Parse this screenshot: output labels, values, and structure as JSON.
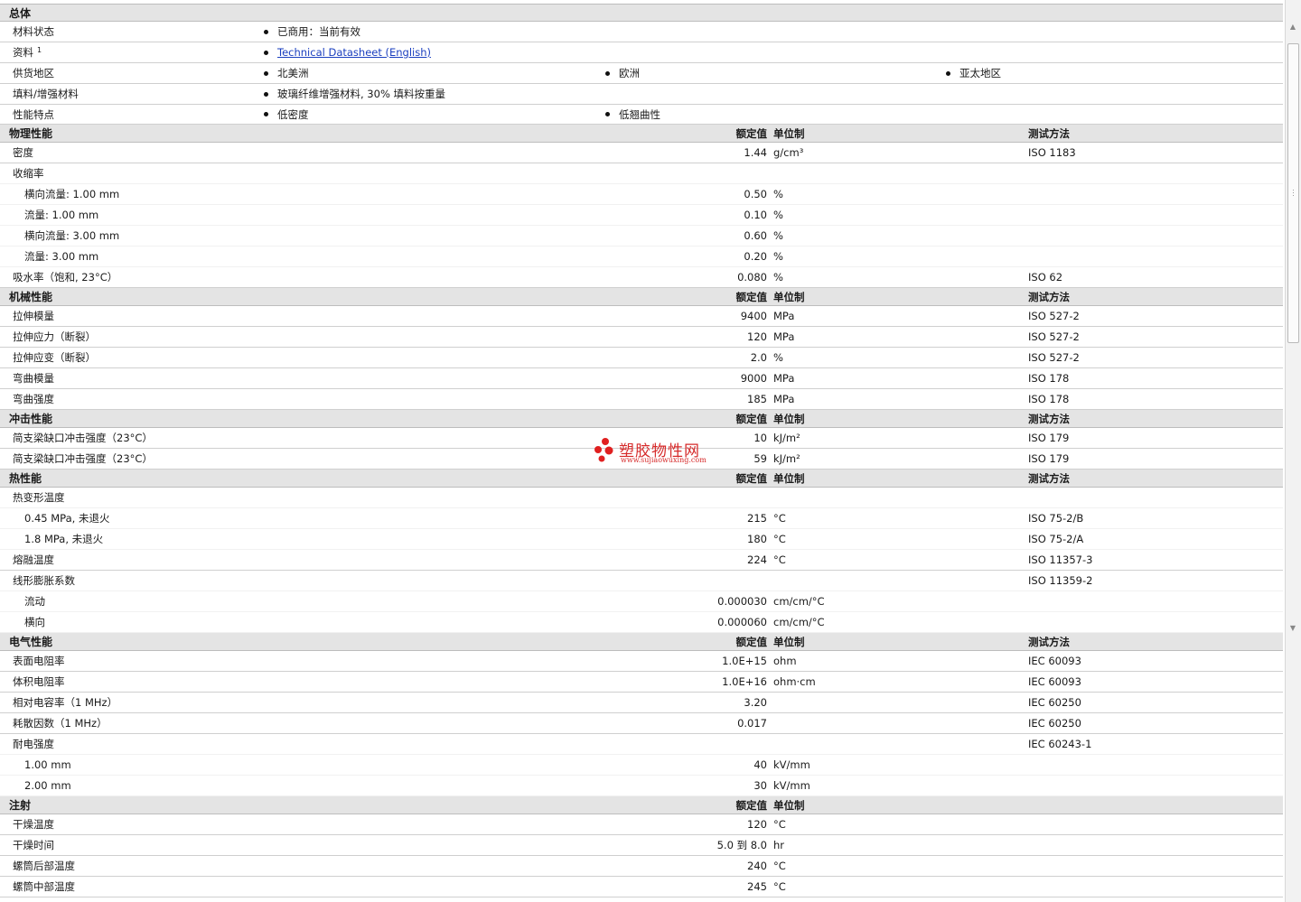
{
  "general": {
    "title": "总体",
    "status_label": "材料状态",
    "status_value": "已商用：当前有效",
    "doc_label": "资料",
    "doc_sup": "1",
    "doc_link": "Technical Datasheet (English)",
    "region_label": "供货地区",
    "regions": [
      "北美洲",
      "欧洲",
      "亚太地区"
    ],
    "filler_label": "填料/增强材料",
    "filler_value": "玻璃纤维增强材料, 30% 填料按重量",
    "features_label": "性能特点",
    "features": [
      "低密度",
      "低翘曲性"
    ]
  },
  "headers": {
    "value": "额定值",
    "unit": "单位制",
    "test": "测试方法"
  },
  "sections": [
    {
      "title": "物理性能",
      "show_test": true,
      "rows": [
        {
          "label": "密度",
          "value": "1.44",
          "unit": "g/cm³",
          "test": "ISO 1183"
        },
        {
          "label": "收缩率",
          "value": "",
          "unit": "",
          "test": ""
        },
        {
          "label": "横向流量: 1.00 mm",
          "indent": true,
          "value": "0.50",
          "unit": "%",
          "test": ""
        },
        {
          "label": "流量: 1.00 mm",
          "indent": true,
          "value": "0.10",
          "unit": "%",
          "test": ""
        },
        {
          "label": "横向流量: 3.00 mm",
          "indent": true,
          "value": "0.60",
          "unit": "%",
          "test": ""
        },
        {
          "label": "流量: 3.00 mm",
          "indent": true,
          "value": "0.20",
          "unit": "%",
          "test": ""
        },
        {
          "label": "吸水率（饱和, 23°C）",
          "value": "0.080",
          "unit": "%",
          "test": "ISO 62"
        }
      ]
    },
    {
      "title": "机械性能",
      "show_test": true,
      "rows": [
        {
          "label": "拉伸模量",
          "value": "9400",
          "unit": "MPa",
          "test": "ISO 527-2"
        },
        {
          "label": "拉伸应力（断裂）",
          "value": "120",
          "unit": "MPa",
          "test": "ISO 527-2"
        },
        {
          "label": "拉伸应变（断裂）",
          "value": "2.0",
          "unit": "%",
          "test": "ISO 527-2"
        },
        {
          "label": "弯曲模量",
          "value": "9000",
          "unit": "MPa",
          "test": "ISO 178"
        },
        {
          "label": "弯曲强度",
          "value": "185",
          "unit": "MPa",
          "test": "ISO 178"
        }
      ]
    },
    {
      "title": "冲击性能",
      "show_test": true,
      "rows": [
        {
          "label": "简支梁缺口冲击强度（23°C）",
          "value": "10",
          "unit": "kJ/m²",
          "test": "ISO 179"
        },
        {
          "label": "简支梁缺口冲击强度（23°C）",
          "value": "59",
          "unit": "kJ/m²",
          "test": "ISO 179"
        }
      ]
    },
    {
      "title": "热性能",
      "show_test": true,
      "rows": [
        {
          "label": "热变形温度",
          "value": "",
          "unit": "",
          "test": ""
        },
        {
          "label": "0.45 MPa, 未退火",
          "indent": true,
          "value": "215",
          "unit": "°C",
          "test": "ISO 75-2/B"
        },
        {
          "label": "1.8 MPa, 未退火",
          "indent": true,
          "value": "180",
          "unit": "°C",
          "test": "ISO 75-2/A"
        },
        {
          "label": "熔融温度",
          "value": "224",
          "unit": "°C",
          "test": "ISO 11357-3"
        },
        {
          "label": "线形膨胀系数",
          "value": "",
          "unit": "",
          "test": "ISO 11359-2"
        },
        {
          "label": "流动",
          "indent": true,
          "value": "0.000030",
          "unit": "cm/cm/°C",
          "test": ""
        },
        {
          "label": "横向",
          "indent": true,
          "value": "0.000060",
          "unit": "cm/cm/°C",
          "test": ""
        }
      ]
    },
    {
      "title": "电气性能",
      "show_test": true,
      "rows": [
        {
          "label": "表面电阻率",
          "value": "1.0E+15",
          "unit": "ohm",
          "test": "IEC 60093"
        },
        {
          "label": "体积电阻率",
          "value": "1.0E+16",
          "unit": "ohm·cm",
          "test": "IEC 60093"
        },
        {
          "label": "相对电容率（1 MHz）",
          "value": "3.20",
          "unit": "",
          "test": "IEC 60250"
        },
        {
          "label": "耗散因数（1 MHz）",
          "value": "0.017",
          "unit": "",
          "test": "IEC 60250"
        },
        {
          "label": "耐电强度",
          "value": "",
          "unit": "",
          "test": "IEC 60243-1"
        },
        {
          "label": "1.00 mm",
          "indent": true,
          "value": "40",
          "unit": "kV/mm",
          "test": ""
        },
        {
          "label": "2.00 mm",
          "indent": true,
          "value": "30",
          "unit": "kV/mm",
          "test": ""
        }
      ]
    },
    {
      "title": "注射",
      "show_test": false,
      "rows": [
        {
          "label": "干燥温度",
          "value": "120",
          "unit": "°C",
          "test": ""
        },
        {
          "label": "干燥时间",
          "value": "5.0 到  8.0",
          "unit": "hr",
          "test": ""
        },
        {
          "label": "螺筒后部温度",
          "value": "240",
          "unit": "°C",
          "test": ""
        },
        {
          "label": "螺筒中部温度",
          "value": "245",
          "unit": "°C",
          "test": ""
        }
      ]
    }
  ],
  "watermark": {
    "name": "塑胶物性网",
    "url": "www.sujiaowuxing.com"
  }
}
